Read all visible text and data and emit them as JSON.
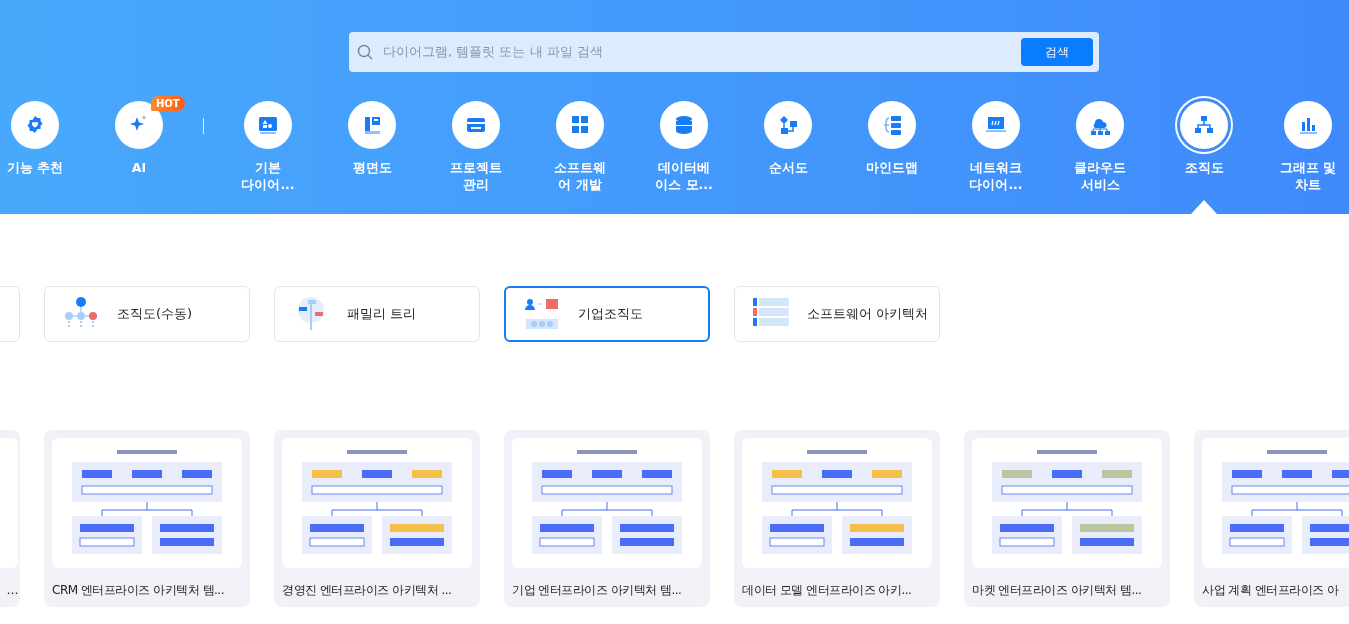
{
  "search": {
    "placeholder": "다이어그램, 템플릿 또는 내 파일 검색",
    "button": "검색"
  },
  "featured": [
    {
      "label": "기능 추천",
      "selected": false
    },
    {
      "label": "AI",
      "selected": false,
      "badge": "HOT"
    }
  ],
  "categories": [
    {
      "label": "기본\n다이어...",
      "selected": false
    },
    {
      "label": "평면도",
      "selected": false
    },
    {
      "label": "프로젝트\n관리",
      "selected": false
    },
    {
      "label": "소프트웨\n어 개발",
      "selected": false
    },
    {
      "label": "데이터베\n이스 모...",
      "selected": false
    },
    {
      "label": "순서도",
      "selected": false
    },
    {
      "label": "마인드맵",
      "selected": false
    },
    {
      "label": "네트워크\n다이어...",
      "selected": false
    },
    {
      "label": "클라우드\n서비스",
      "selected": false
    },
    {
      "label": "조직도",
      "selected": true
    },
    {
      "label": "그래프 및\n차트",
      "selected": false
    }
  ],
  "subcategories": [
    {
      "cut_off": true,
      "selected": false
    },
    {
      "label": "조직도(수동)",
      "selected": false
    },
    {
      "label": "패밀리 트리",
      "selected": false
    },
    {
      "label": "기업조직도",
      "selected": true
    },
    {
      "label": "소프트웨어 아키텍처",
      "selected": false
    }
  ],
  "templates": [
    {
      "title": "…",
      "cut_off": true
    },
    {
      "title": "CRM 엔터프라이즈 아키텍처 템..."
    },
    {
      "title": "경영진 엔터프라이즈 아키텍처 ..."
    },
    {
      "title": "기업 엔터프라이즈 아키텍처 템..."
    },
    {
      "title": "데이터 모델 엔터프라이즈 아키..."
    },
    {
      "title": "마켓 엔터프라이즈 아키텍처 템..."
    },
    {
      "title": "사업 계획 엔터프라이즈 아"
    }
  ]
}
